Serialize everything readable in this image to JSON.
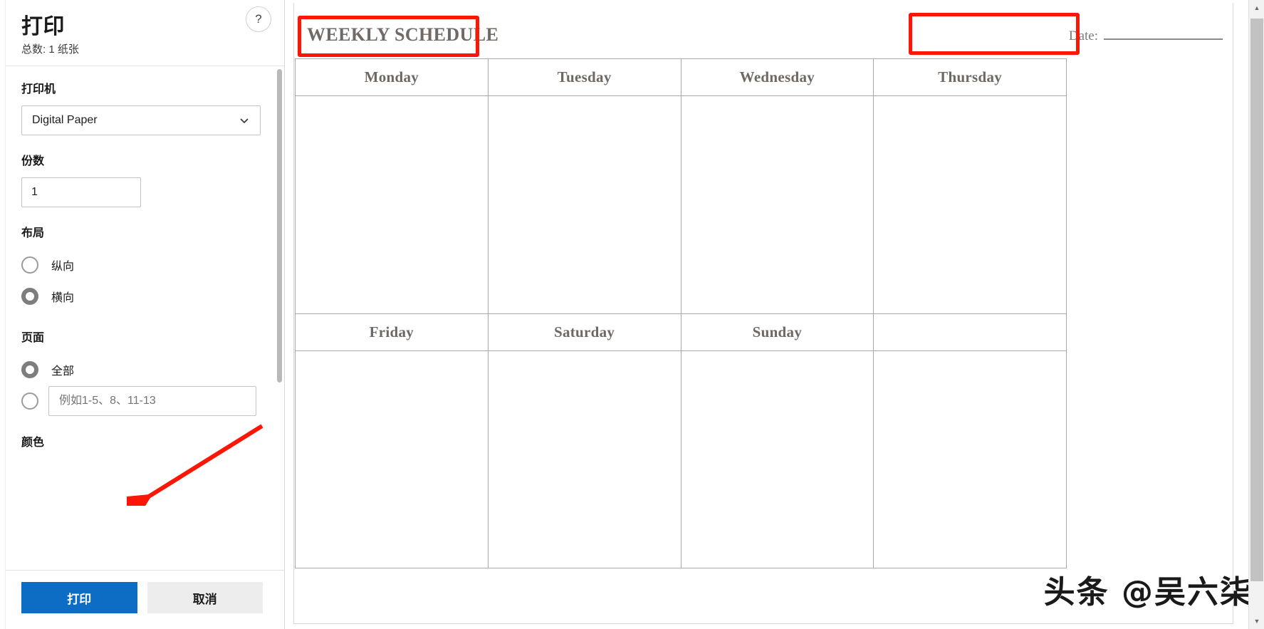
{
  "print_dialog": {
    "title": "打印",
    "summary": "总数: 1 纸张",
    "help_icon": "?",
    "printer": {
      "label": "打印机",
      "selected": "Digital Paper",
      "caret_icon": "chevron-down-icon"
    },
    "copies": {
      "label": "份数",
      "value": "1"
    },
    "layout": {
      "label": "布局",
      "options": [
        {
          "label": "纵向",
          "selected": false
        },
        {
          "label": "横向",
          "selected": true
        }
      ]
    },
    "pages": {
      "label": "页面",
      "options": [
        {
          "label": "全部",
          "selected": true
        },
        {
          "label": "",
          "selected": false
        }
      ],
      "range_placeholder": "例如1-5、8、11-13",
      "range_value": ""
    },
    "color": {
      "label": "颜色"
    },
    "actions": {
      "print": "打印",
      "cancel": "取消"
    }
  },
  "preview": {
    "document": {
      "title": "WEEKLY SCHEDULE",
      "date_label": "Date:",
      "date_value": "",
      "week_rows": [
        [
          "Monday",
          "Tuesday",
          "Wednesday",
          "Thursday"
        ],
        [
          "Friday",
          "Saturday",
          "Sunday",
          ""
        ]
      ]
    },
    "watermark": "头条 @吴六柒"
  },
  "annotations": {
    "highlight_color": "#fc1605",
    "boxes": [
      "title-highlight",
      "date-highlight"
    ],
    "arrow": "print-button-arrow"
  },
  "scrollbars": {
    "up_arrow": "▲",
    "down_arrow": "▼"
  }
}
